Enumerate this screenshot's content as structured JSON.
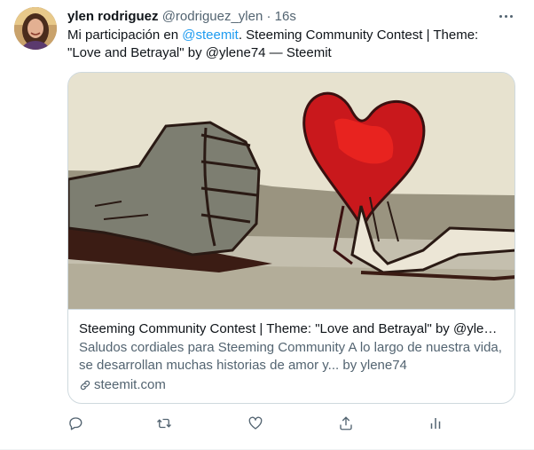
{
  "tweet": {
    "author_name": "ylen rodriguez",
    "author_handle": "@rodriguez_ylen",
    "separator": "·",
    "time": "16s",
    "text_before": "Mi participación en ",
    "mention": "@steemit",
    "text_after": ". Steeming Community Contest | Theme: \"Love and Betrayal\" by @ylene74 — Steemit"
  },
  "card": {
    "title": "Steeming Community Contest | Theme: \"Love and Betrayal\" by @ylen…",
    "description": "Saludos cordiales para Steeming Community A lo largo de nuestra vida, se desarrollan muchas historias de amor y... by ylene74",
    "domain": "steemit.com"
  },
  "icons": {
    "more": "more-dots-icon",
    "link": "link-icon",
    "reply": "reply-icon",
    "retweet": "retweet-icon",
    "like": "heart-icon",
    "share": "share-icon",
    "analytics": "analytics-icon"
  },
  "colors": {
    "accent": "#1d9bf0",
    "secondary_text": "#536471",
    "border": "#cfd9de"
  }
}
